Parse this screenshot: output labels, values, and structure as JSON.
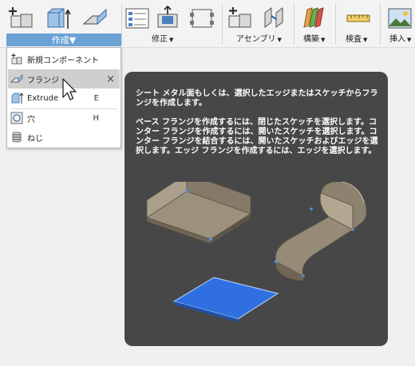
{
  "ribbon": {
    "groups": [
      {
        "label": "作成",
        "active": true
      },
      {
        "label": "修正",
        "active": false
      },
      {
        "label": "アセンブリ",
        "active": false
      },
      {
        "label": "構築",
        "active": false
      },
      {
        "label": "検査",
        "active": false
      },
      {
        "label": "挿入",
        "active": false
      }
    ],
    "icons": [
      "new-component-icon",
      "extrude-icon",
      "flange-icon",
      "modify-table-icon",
      "press-pull-icon",
      "align-icon",
      "new-assembly-icon",
      "joint-icon",
      "plane-icon",
      "measure-icon",
      "insert-image-icon"
    ]
  },
  "menu": {
    "items": [
      {
        "label": "新規コンポーネント",
        "shortcut": "",
        "icon": "new-component-icon"
      },
      {
        "label": "フランジ",
        "shortcut": "",
        "icon": "flange-icon",
        "highlighted": true,
        "pin": "×"
      },
      {
        "label": "Extrude",
        "shortcut": "E",
        "icon": "extrude-icon"
      },
      {
        "label": "穴",
        "shortcut": "H",
        "icon": "hole-icon"
      },
      {
        "label": "ねじ",
        "shortcut": "",
        "icon": "thread-icon"
      }
    ]
  },
  "tooltip": {
    "summary": "シート メタル面もしくは、選択したエッジまたはスケッチからフランジを作成します。",
    "details": "ベース フランジを作成するには、閉じたスケッチを選択します。コンター フランジを作成するには、開いたスケッチを選択します。コンター フランジを結合するには、開いたスケッチおよびエッジを選択します。エッジ フランジを作成するには、エッジを選択します。"
  },
  "colors": {
    "ribbon_active": "#6aa2d5",
    "tooltip_bg": "#474747",
    "sheet_metal": "#8a7f6c",
    "sketch_profile": "#2f6fe0"
  }
}
